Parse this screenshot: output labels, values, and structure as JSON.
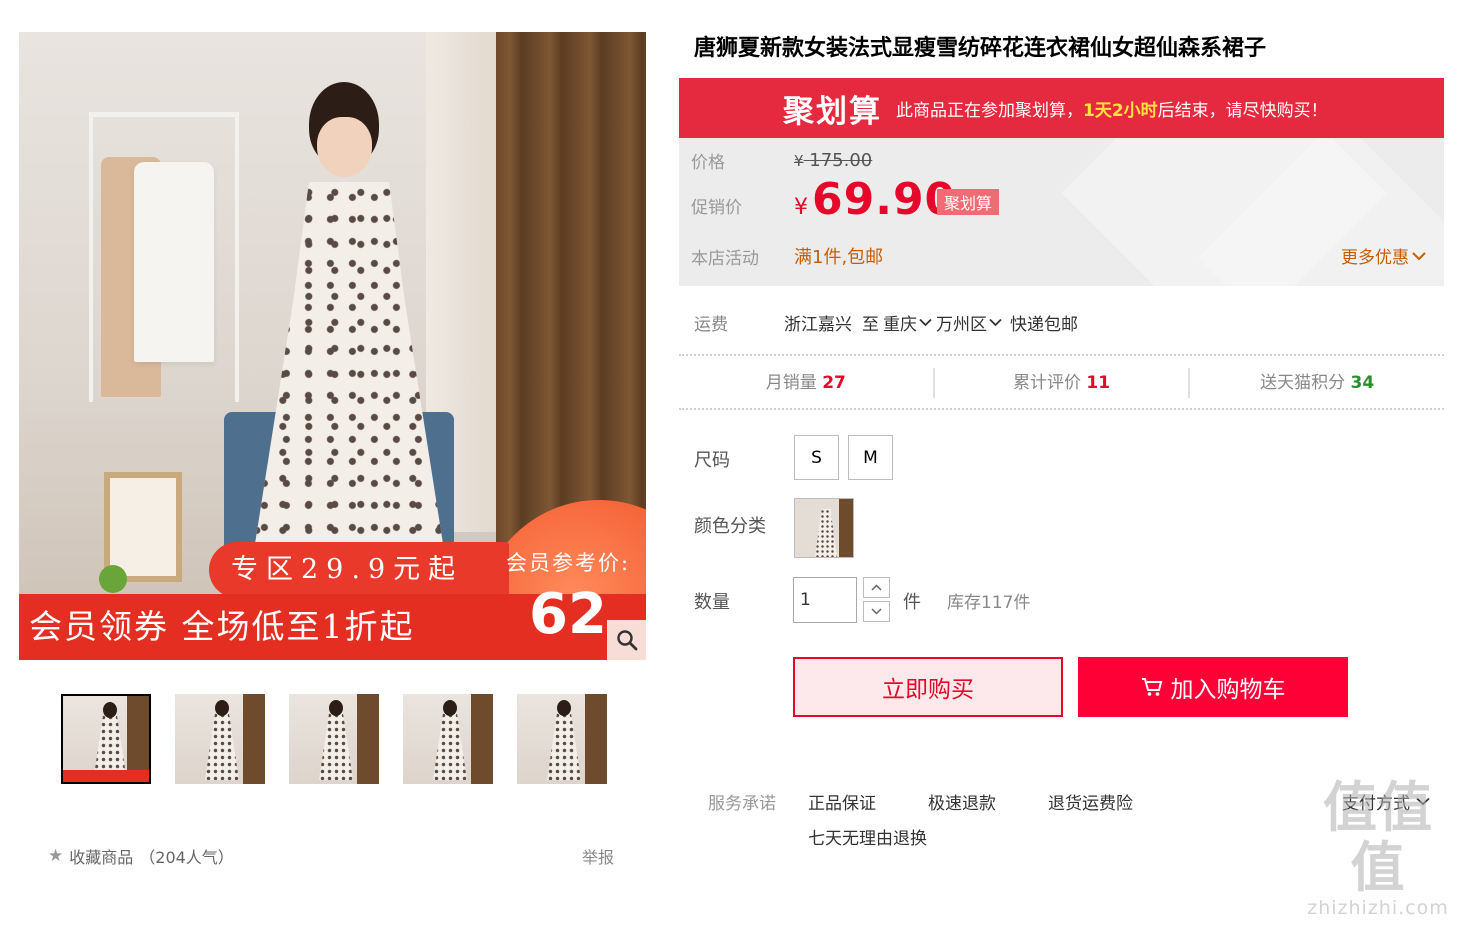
{
  "product": {
    "title": "唐狮夏新款女装法式显瘦雪纺碎花连衣裙仙女超仙森系裙子"
  },
  "gallery": {
    "promo_tag": "专区29.9元起",
    "promo_band": "会员领券 全场低至1折起",
    "member_label": "会员参考价:",
    "member_price": "62",
    "thumbnail_count": 5
  },
  "juhuasuan": {
    "logo": "聚划算",
    "msg_before": "此商品正在参加聚划算，",
    "msg_highlight": "1天2小时",
    "msg_after": "后结束，请尽快购买！"
  },
  "price": {
    "label_price": "价格",
    "currency": "¥",
    "original": "175.00",
    "label_promo": "促销价",
    "promo": "69.90",
    "promo_tag": "聚划算",
    "label_activity": "本店活动",
    "activity": "满1件,包邮",
    "more_offers": "更多优惠"
  },
  "shipping": {
    "label": "运费",
    "origin": "浙江嘉兴",
    "to": "至",
    "city": "重庆",
    "district": "万州区",
    "method": "快递包邮"
  },
  "stats": {
    "monthly_sales_label": "月销量",
    "monthly_sales": "27",
    "reviews_label": "累计评价",
    "reviews": "11",
    "points_label": "送天猫积分",
    "points": "34"
  },
  "options": {
    "size_label": "尺码",
    "sizes": [
      "S",
      "M"
    ],
    "color_label": "颜色分类",
    "qty_label": "数量",
    "qty_value": "1",
    "qty_unit": "件",
    "stock": "库存117件"
  },
  "actions": {
    "buy_now": "立即购买",
    "add_cart": "加入购物车"
  },
  "services": {
    "label": "服务承诺",
    "items": [
      "正品保证",
      "极速退款",
      "退货运费险",
      "七天无理由退换"
    ],
    "payment": "支付方式"
  },
  "footer": {
    "favorite": "收藏商品",
    "popularity": "（204人气）",
    "report": "举报"
  },
  "watermark": {
    "big": "值值值",
    "small": "zhizhizhi.com"
  },
  "colors": {
    "accent_red": "#e5082a",
    "cart_red": "#ff0036",
    "ju_red": "#e5293e",
    "activity_orange": "#c85d00"
  }
}
